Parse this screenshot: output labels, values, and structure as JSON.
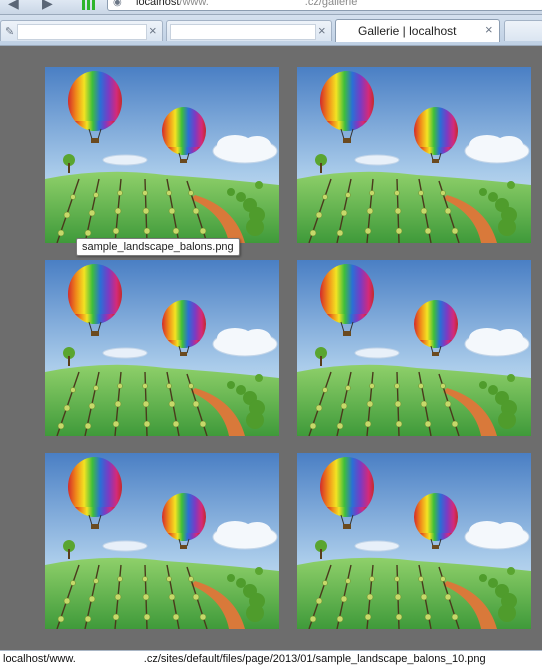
{
  "browser": {
    "address": {
      "host": "localhost",
      "path_prefix": "/www.",
      "path_suffix": ".cz/gallerie"
    },
    "tabs": [
      {
        "title": "",
        "close": "×"
      },
      {
        "title": "",
        "close": "×"
      },
      {
        "title": "Gallerie | localhost",
        "close": "×"
      }
    ]
  },
  "gallery": {
    "tooltip": "sample_landscape_balons.png",
    "images": [
      {
        "icon": "landscape-balloons-image"
      },
      {
        "icon": "landscape-balloons-image"
      },
      {
        "icon": "landscape-balloons-image"
      },
      {
        "icon": "landscape-balloons-image"
      },
      {
        "icon": "landscape-balloons-image"
      },
      {
        "icon": "landscape-balloons-image"
      }
    ]
  },
  "status": {
    "prefix": "localhost/www.",
    "suffix": ".cz/sites/default/files/page/2013/01/sample_landscape_balons_10.png"
  },
  "colors": {
    "background": "#6d6d6d",
    "sky_top": "#4f86c9",
    "grass": "#5bb84a"
  }
}
